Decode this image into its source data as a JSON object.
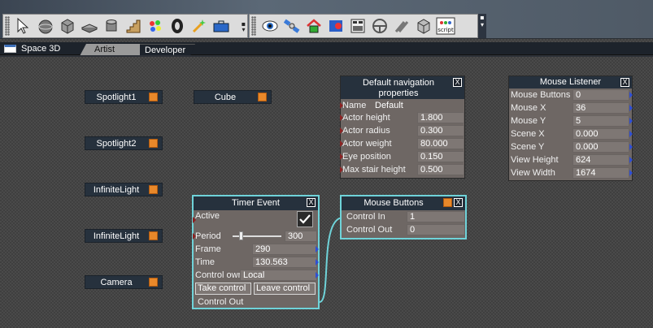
{
  "toolbar": {
    "tools": [
      "select-arrow-icon",
      "sphere-icon",
      "cube-icon",
      "plane-icon",
      "cylinder-icon",
      "stairs-icon",
      "paint-palette-icon",
      "torus-icon",
      "magic-wand-icon",
      "toolbox-icon",
      "eye-icon",
      "satellite-icon",
      "home-icon",
      "record-icon",
      "grid-panel-icon",
      "steering-wheel-icon",
      "fork-icon",
      "box-icon",
      "script-icon"
    ],
    "script_label": "script"
  },
  "space": {
    "label": "Space 3D"
  },
  "tabs": [
    {
      "label": "Artist",
      "active": true
    },
    {
      "label": "Developer",
      "active": false
    }
  ],
  "nodes": [
    {
      "label": "Spotlight1"
    },
    {
      "label": "Spotlight2"
    },
    {
      "label": "InfiniteLight"
    },
    {
      "label": "InfiniteLight"
    },
    {
      "label": "Camera"
    },
    {
      "label": "Cube"
    }
  ],
  "nav_props": {
    "title": "Default navigation properties",
    "close": "X",
    "rows": [
      {
        "label": "Name",
        "value": "Default"
      },
      {
        "label": "Actor height",
        "value": "1.800"
      },
      {
        "label": "Actor radius",
        "value": "0.300"
      },
      {
        "label": "Actor weight",
        "value": "80.000"
      },
      {
        "label": "Eye position",
        "value": "0.150"
      },
      {
        "label": "Max stair height",
        "value": "0.500"
      }
    ]
  },
  "mouse_listener": {
    "title": "Mouse Listener",
    "close": "X",
    "rows": [
      {
        "label": "Mouse Buttons",
        "value": "0"
      },
      {
        "label": "Mouse X",
        "value": "36"
      },
      {
        "label": "Mouse Y",
        "value": "5"
      },
      {
        "label": "Scene X",
        "value": "0.000"
      },
      {
        "label": "Scene Y",
        "value": "0.000"
      },
      {
        "label": "View Height",
        "value": "624"
      },
      {
        "label": "View Width",
        "value": "1674"
      }
    ]
  },
  "timer_event": {
    "title": "Timer Event",
    "close": "X",
    "active_label": "Active",
    "active_checked": true,
    "period_label": "Period",
    "period_value": "300",
    "period_slider_fraction": 0.15,
    "rows": [
      {
        "label": "Frame",
        "value": "290"
      },
      {
        "label": "Time",
        "value": "130.563"
      },
      {
        "label": "Control own",
        "value": "Local"
      }
    ],
    "take_control": "Take control",
    "leave_control": "Leave control",
    "control_out": "Control Out"
  },
  "mouse_buttons": {
    "title": "Mouse Buttons",
    "close": "X",
    "rows": [
      {
        "label": "Control In",
        "value": "1"
      },
      {
        "label": "Control Out",
        "value": "0"
      }
    ]
  },
  "colors": {
    "accent_orange": "#e8882a",
    "selection_cyan": "#6fd3d9",
    "header_dark": "#26313d",
    "input_port": "#8b2222",
    "output_port": "#2f4fd6"
  }
}
